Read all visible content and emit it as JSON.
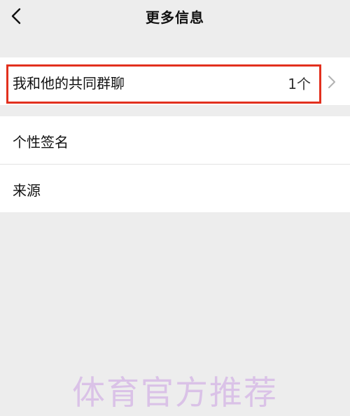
{
  "nav": {
    "title": "更多信息",
    "back_icon": "chevron-left-icon"
  },
  "rows": [
    {
      "label": "我和他的共同群聊",
      "value": "1个",
      "icon": "chevron-right-icon"
    },
    {
      "label": "个性签名"
    },
    {
      "label": "来源"
    }
  ],
  "colors": {
    "background": "#ededed",
    "row_background": "#ffffff",
    "highlight": "#e2301e",
    "watermark": "#d6b8e6"
  },
  "watermark": "体育官方推荐"
}
